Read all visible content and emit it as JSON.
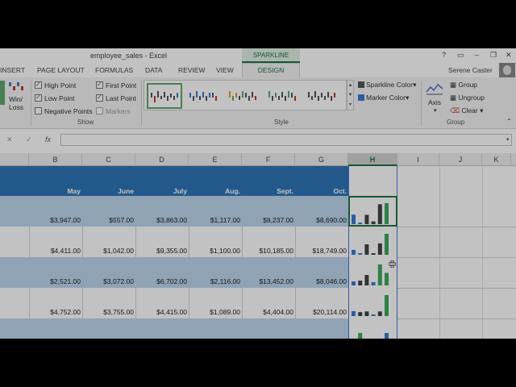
{
  "window": {
    "title": "employee_sales - Excel",
    "contextual_tab_group": "SPARKLINE TOOLS",
    "help_label": "?",
    "user_name": "Serene Caster"
  },
  "ribbon_tabs": [
    "INSERT",
    "PAGE LAYOUT",
    "FORMULAS",
    "DATA",
    "REVIEW",
    "VIEW",
    "DESIGN"
  ],
  "active_tab": "DESIGN",
  "ribbon": {
    "type_group": {
      "winloss_label_1": "Win/",
      "winloss_label_2": "Loss"
    },
    "show_group": {
      "label": "Show",
      "checkboxes": [
        {
          "label": "High Point",
          "checked": true
        },
        {
          "label": "Low Point",
          "checked": true
        },
        {
          "label": "Negative Points",
          "checked": false
        },
        {
          "label": "First Point",
          "checked": true
        },
        {
          "label": "Last Point",
          "checked": true
        },
        {
          "label": "Markers",
          "checked": false,
          "disabled": true
        }
      ]
    },
    "style_group": {
      "label": "Style",
      "sparkline_color": "Sparkline Color",
      "marker_color": "Marker Color"
    },
    "group_group": {
      "label": "Group",
      "axis": "Axis",
      "group": "Group",
      "ungroup": "Ungroup",
      "clear": "Clear"
    }
  },
  "formula_bar": {
    "fx": "fx",
    "value": ""
  },
  "columns": [
    "B",
    "C",
    "D",
    "E",
    "F",
    "G",
    "H",
    "I",
    "J",
    "K"
  ],
  "active_column": "H",
  "months": [
    "May",
    "June",
    "July",
    "Aug.",
    "Sept.",
    "Oct."
  ],
  "rows": [
    [
      "$3,947.00",
      "$557.00",
      "$3,863.00",
      "$1,117.00",
      "$8,237.00",
      "$8,690.00"
    ],
    [
      "$4,411.00",
      "$1,042.00",
      "$9,355.00",
      "$1,100.00",
      "$10,185.00",
      "$18,749.00"
    ],
    [
      "$2,521.00",
      "$3,072.00",
      "$6,702.00",
      "$2,116.00",
      "$13,452.00",
      "$8,046.00"
    ],
    [
      "$4,752.00",
      "$3,755.00",
      "$4,415.00",
      "$1,089.00",
      "$4,404.00",
      "$20,114.00"
    ]
  ],
  "colors": {
    "excel_green": "#217346",
    "header_blue": "#2e75b6",
    "row_band": "#bdd7ee",
    "spark_first": "#3a7bd5",
    "spark_last": "#3aaa5c",
    "spark_mid": "#444444"
  }
}
